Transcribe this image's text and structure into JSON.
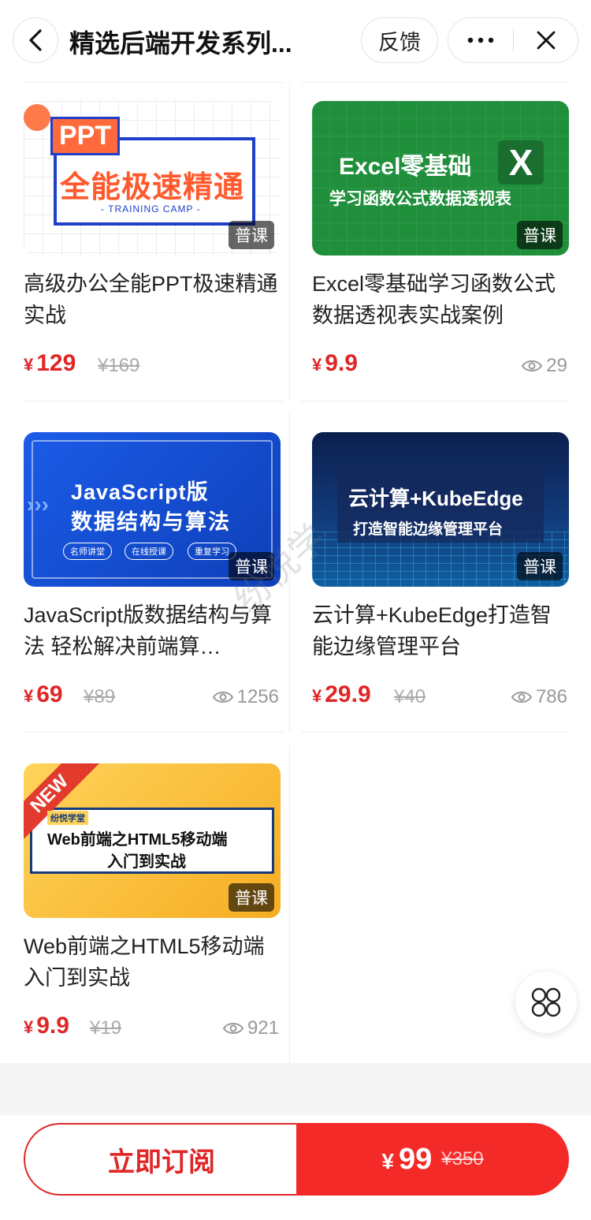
{
  "header": {
    "title": "精选后端开发系列...",
    "feedback_label": "反馈"
  },
  "courses": [
    {
      "title": "高级办公全能PPT极速精通实战",
      "price": "129",
      "original_price": "¥169",
      "views": "",
      "badge": "普课",
      "thumb": {
        "tag": "PPT",
        "line1": "全能极速精通",
        "line2": "- TRAINING CAMP -"
      }
    },
    {
      "title": "Excel零基础学习函数公式数据透视表实战案例",
      "price": "9.9",
      "original_price": "",
      "views": "29",
      "badge": "普课",
      "thumb": {
        "line1": "Excel零基础",
        "icon": "X",
        "line2": "学习函数公式数据透视表"
      }
    },
    {
      "title": "JavaScript版数据结构与算法 轻松解决前端算…",
      "price": "69",
      "original_price": "¥89",
      "views": "1256",
      "badge": "普课",
      "thumb": {
        "line1": "JavaScript版",
        "line2": "数据结构与算法",
        "pills": [
          "名师讲堂",
          "在线授课",
          "重复学习"
        ]
      }
    },
    {
      "title": "云计算+KubeEdge打造智能边缘管理平台",
      "price": "29.9",
      "original_price": "¥40",
      "views": "786",
      "badge": "普课",
      "thumb": {
        "line1": "云计算+KubeEdge",
        "line2": "打造智能边缘管理平台"
      }
    },
    {
      "title": "Web前端之HTML5移动端入门到实战",
      "price": "9.9",
      "original_price": "¥19",
      "views": "921",
      "badge": "普课",
      "thumb": {
        "ribbon": "NEW",
        "brand": "纷悦学堂",
        "line1": "Web前端之HTML5移动端",
        "line2": "入门到实战"
      }
    }
  ],
  "watermark": "纷悦学",
  "currency_symbol": "¥",
  "bottom_bar": {
    "subscribe_label": "立即订阅",
    "price": "99",
    "original_price": "¥350"
  },
  "colors": {
    "accent": "#e02626",
    "buy_button": "#f42a28"
  }
}
